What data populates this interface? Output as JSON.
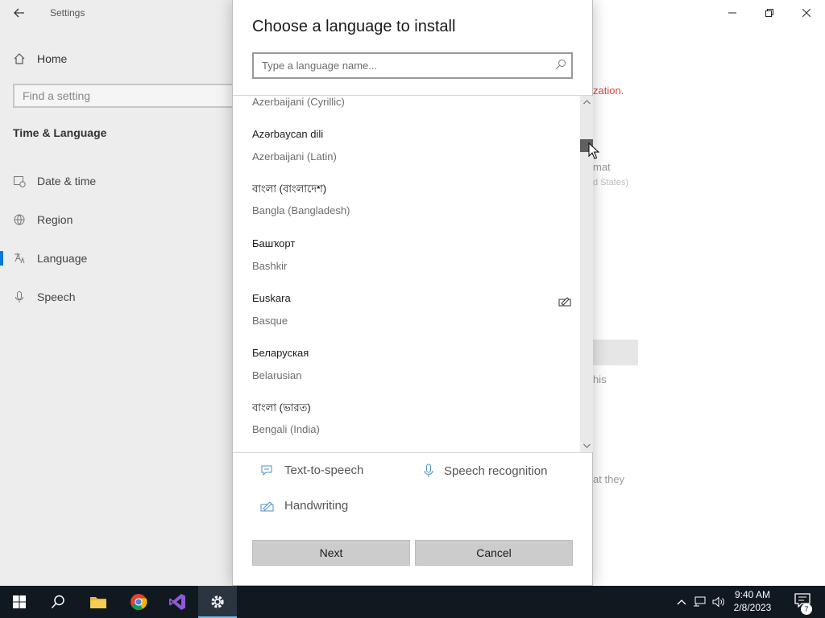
{
  "settings": {
    "window_title": "Settings",
    "home_label": "Home",
    "search_placeholder": "Find a setting",
    "section_title": "Time & Language",
    "nav": [
      {
        "label": "Date & time"
      },
      {
        "label": "Region"
      },
      {
        "label": "Language"
      },
      {
        "label": "Speech"
      }
    ],
    "bg_fragments": {
      "red": "zation.",
      "format": "mat",
      "region_partial": "d States)",
      "this": "his",
      "they": "at they"
    }
  },
  "dialog": {
    "title": "Choose a language to install",
    "search_placeholder": "Type a language name...",
    "languages": [
      {
        "native": "",
        "english": "Azerbaijani (Cyrillic)",
        "handwriting": false
      },
      {
        "native": "Azərbaycan dili",
        "english": "Azerbaijani (Latin)",
        "handwriting": false
      },
      {
        "native": "বাংলা (বাংলাদেশ)",
        "english": "Bangla (Bangladesh)",
        "handwriting": false
      },
      {
        "native": "Башҡорт",
        "english": "Bashkir",
        "handwriting": false
      },
      {
        "native": "Euskara",
        "english": "Basque",
        "handwriting": true
      },
      {
        "native": "Беларуская",
        "english": "Belarusian",
        "handwriting": false
      },
      {
        "native": "বাংলা (ভারত)",
        "english": "Bengali (India)",
        "handwriting": false
      }
    ],
    "features": {
      "tts": "Text-to-speech",
      "speech": "Speech recognition",
      "handwriting": "Handwriting"
    },
    "next_label": "Next",
    "cancel_label": "Cancel"
  },
  "taskbar": {
    "time": "9:40 AM",
    "date": "2/8/2023",
    "notification_count": "7"
  }
}
